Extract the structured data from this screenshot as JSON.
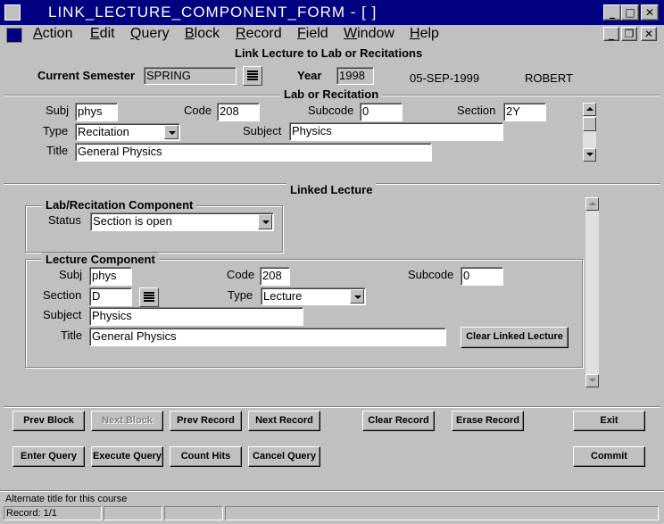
{
  "window": {
    "title": "LINK_LECTURE_COMPONENT_FORM - [ ]",
    "minimize_glyph": "_",
    "maximize_glyph": "□",
    "close_glyph": "✕",
    "mdi_minimize_glyph": "_",
    "mdi_restore_glyph": "❐",
    "mdi_close_glyph": "✕"
  },
  "menu": {
    "items": [
      {
        "ul": "A",
        "rest": "ction"
      },
      {
        "ul": "E",
        "rest": "dit"
      },
      {
        "ul": "Q",
        "rest": "uery"
      },
      {
        "ul": "B",
        "rest": "lock"
      },
      {
        "ul": "R",
        "rest": "ecord"
      },
      {
        "ul": "F",
        "rest": "ield"
      },
      {
        "ul": "W",
        "rest": "indow"
      },
      {
        "ul": "H",
        "rest": "elp"
      }
    ]
  },
  "header": {
    "form_title": "Link Lecture to Lab or Recitations",
    "current_semester_label": "Current Semester",
    "current_semester_value": "SPRING",
    "year_label": "Year",
    "year_value": "1998",
    "date": "05-SEP-1999",
    "user": "ROBERT"
  },
  "lab": {
    "section_title": "Lab or Recitation",
    "subj_label": "Subj",
    "subj_value": "phys",
    "code_label": "Code",
    "code_value": "208",
    "subcode_label": "Subcode",
    "subcode_value": "0",
    "section_label": "Section",
    "section_value": "2Y",
    "type_label": "Type",
    "type_value": "Recitation",
    "subject_label": "Subject",
    "subject_value": "Physics",
    "title_label": "Title",
    "title_value": "General Physics"
  },
  "linked": {
    "section_title": "Linked Lecture",
    "component_title": "Lab/Recitation Component",
    "status_label": "Status",
    "status_value": "Section  is open",
    "lecture_title": "Lecture Component",
    "subj_label": "Subj",
    "subj_value": "phys",
    "code_label": "Code",
    "code_value": "208",
    "subcode_label": "Subcode",
    "subcode_value": "0",
    "section_label": "Section",
    "section_value": "D",
    "type_label": "Type",
    "type_value": "Lecture",
    "subject_label": "Subject",
    "subject_value": "Physics",
    "title_label": "Title",
    "title_value": "General Physics",
    "clear_button": "Clear Linked Lecture"
  },
  "buttons": {
    "prev_block": "Prev Block",
    "next_block": "Next Block",
    "prev_record": "Prev Record",
    "next_record": "Next Record",
    "clear_record": "Clear Record",
    "erase_record": "Erase Record",
    "exit": "Exit",
    "enter_query": "Enter Query",
    "execute_query": "Execute Query",
    "count_hits": "Count Hits",
    "cancel_query": "Cancel Query",
    "commit": "Commit"
  },
  "status": {
    "hint": "Alternate title for this course",
    "record": "Record: 1/1"
  }
}
